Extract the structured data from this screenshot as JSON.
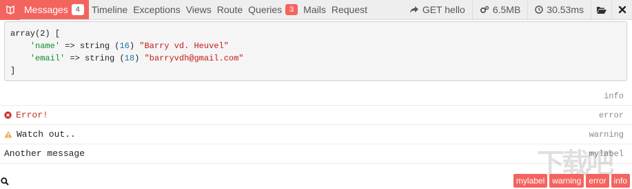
{
  "toolbar": {
    "tabs": [
      {
        "label": "Messages",
        "badge": "4"
      },
      {
        "label": "Timeline"
      },
      {
        "label": "Exceptions"
      },
      {
        "label": "Views"
      },
      {
        "label": "Route"
      },
      {
        "label": "Queries",
        "badge": "3"
      },
      {
        "label": "Mails"
      },
      {
        "label": "Request"
      }
    ],
    "route": "GET hello",
    "memory": "6.5MB",
    "time": "30.53ms"
  },
  "dump": {
    "open": "array(2) [",
    "rows": [
      {
        "key": "'name'",
        "arrow": " => string (",
        "len": "16",
        "close": ") ",
        "value": "\"Barry vd. Heuvel\""
      },
      {
        "key": "'email'",
        "arrow": " => string (",
        "len": "18",
        "close": ") ",
        "value": "\"barryvdh@gmail.com\""
      }
    ],
    "close": "]",
    "label": "info"
  },
  "messages": [
    {
      "text": "Error!",
      "label": "error",
      "icon": "error-icon"
    },
    {
      "text": "Watch out..",
      "label": "warning",
      "icon": "warning-icon"
    },
    {
      "text": "Another message",
      "label": "mylabel"
    }
  ],
  "filters": [
    "mylabel",
    "warning",
    "error",
    "info"
  ],
  "watermark": "下载吧",
  "colors": {
    "accent": "#f4645f",
    "error": "#c9302c",
    "warning": "#f0ad4e"
  }
}
